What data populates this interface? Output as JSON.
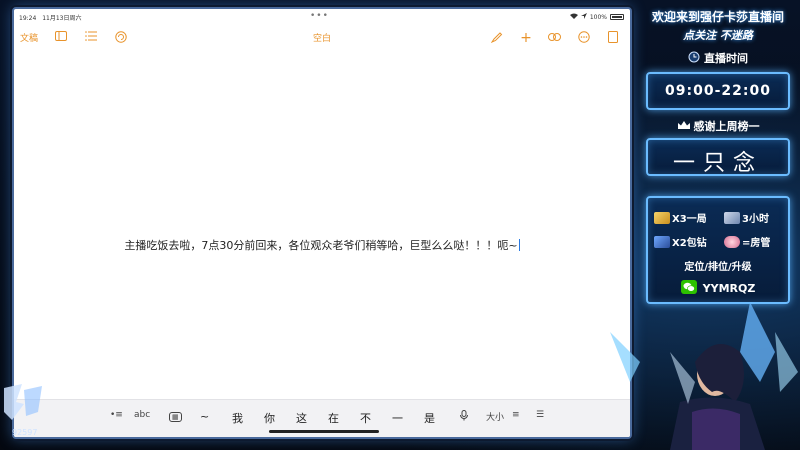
{
  "status_bar": {
    "time": "19:24",
    "date": "11月13日周六",
    "battery": "100%"
  },
  "toolbar": {
    "back_label": "文稿",
    "doc_title": "空白",
    "icons": [
      "sidebar-icon",
      "list-icon",
      "undo-icon",
      "brush-icon",
      "add-icon",
      "collab-icon",
      "more-icon",
      "document-icon"
    ]
  },
  "document": {
    "text": "主播吃饭去啦，7点30分前回来，各位观众老爷们稍等哈，巨型么么哒！！！呃~"
  },
  "keyboard_bar": {
    "abc": "abc",
    "tilde": "~",
    "suggestions": [
      "我",
      "你",
      "这",
      "在",
      "不",
      "一",
      "是"
    ],
    "size_label": "大小"
  },
  "panel": {
    "welcome": "欢迎来到强仔卡莎直播间",
    "follow": "点关注 不迷路",
    "schedule_title": "直播时间",
    "schedule": "09:00-22:00",
    "thanks_title": "感谢上周榜一",
    "top_fan": "一只念",
    "perks": [
      "X3一局",
      "3小时",
      "X2包钻",
      "=房管"
    ],
    "services": "定位/排位/升级",
    "wechat": "YYMRQZ"
  },
  "streamer": {
    "id_partial": "92597"
  },
  "colors": {
    "accent": "#e8932b",
    "panel_border": "#6bbcff",
    "panel_bg": "#0a2b55"
  }
}
